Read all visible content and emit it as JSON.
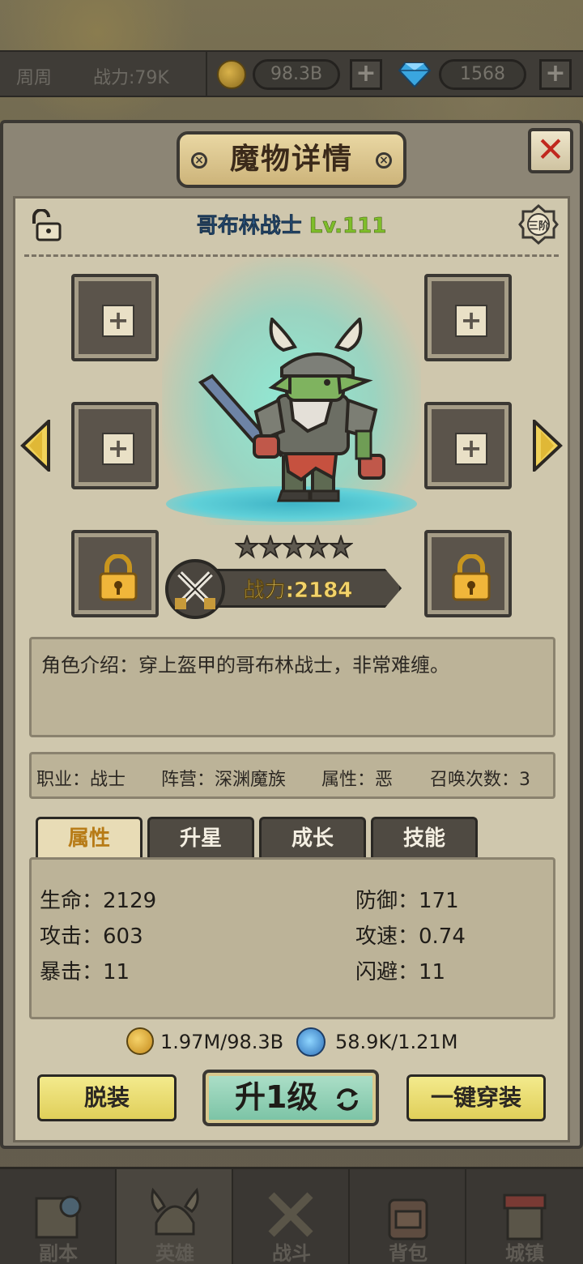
{
  "topbar": {
    "player_name": "周周",
    "power": "战力:79K",
    "gold": "98.3B",
    "diamonds": "1568",
    "plus": "+"
  },
  "dialog": {
    "title": "魔物详情",
    "close": "✕",
    "hero_name": "哥布林战士",
    "hero_level": "Lv.111",
    "grade": "三阶",
    "stars": 5,
    "power": "战力:2184",
    "description": "角色介绍：穿上盔甲的哥布林战士，非常难缠。"
  },
  "info": {
    "job": "职业：战士",
    "faction": "阵营：深渊魔族",
    "attribute": "属性：恶",
    "summons": "召唤次数：3"
  },
  "tabs": [
    "属性",
    "升星",
    "成长",
    "技能"
  ],
  "stats": {
    "hp": "生命：2129",
    "defense": "防御：171",
    "attack": "攻击：603",
    "attack_speed": "攻速：0.74",
    "crit": "暴击：11",
    "dodge": "闪避：11"
  },
  "costs": {
    "gold": "1.97M/98.3B",
    "exp": "58.9K/1.21M"
  },
  "buttons": {
    "unequip": "脱装",
    "level_up": "升1级",
    "equip_all": "一键穿装"
  },
  "nav": [
    "副本",
    "英雄",
    "战斗",
    "背包",
    "城镇"
  ],
  "colors": {
    "level_green": "#7fbe2a",
    "name_blue": "#2f5e8c",
    "power_gold": "#f2d36b",
    "active_tab": "#b77b16",
    "close_red": "#c0281e"
  }
}
